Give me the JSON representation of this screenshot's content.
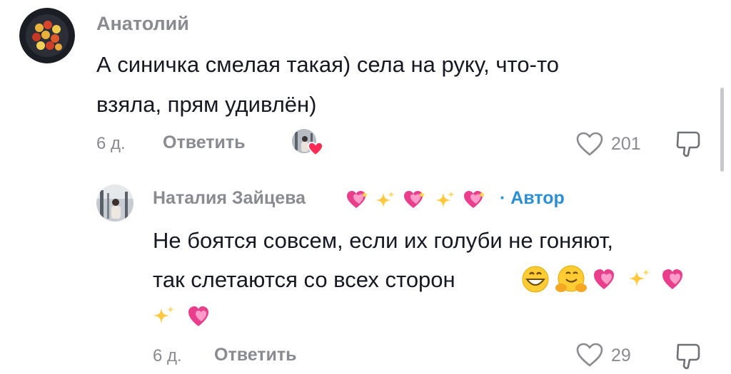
{
  "comment": {
    "author": "Анатолий",
    "text_line1": "А синичка смелая такая) села на руку, что-то",
    "text_line2": "взяла, прям удивлён)",
    "time": "6 д.",
    "reply_label": "Ответить",
    "likes": "201"
  },
  "reply": {
    "author": "Наталия Зайцева",
    "author_badge": "· Автор",
    "text_line1": "Не боятся совсем, если их голуби не гоняют,",
    "text_line2": "так слетаются со всех сторон",
    "time": "6 д.",
    "reply_label": "Ответить",
    "likes": "29"
  },
  "colors": {
    "text": "#161823",
    "secondary": "#8a8b91",
    "author_badge": "#2a8fd6",
    "heart_badge": "#fe2c55"
  },
  "icons": [
    "heart-outline-icon",
    "dislike-icon",
    "sparkling-heart-icon",
    "sparkles-icon",
    "grinning-face-icon",
    "hugging-face-icon"
  ]
}
